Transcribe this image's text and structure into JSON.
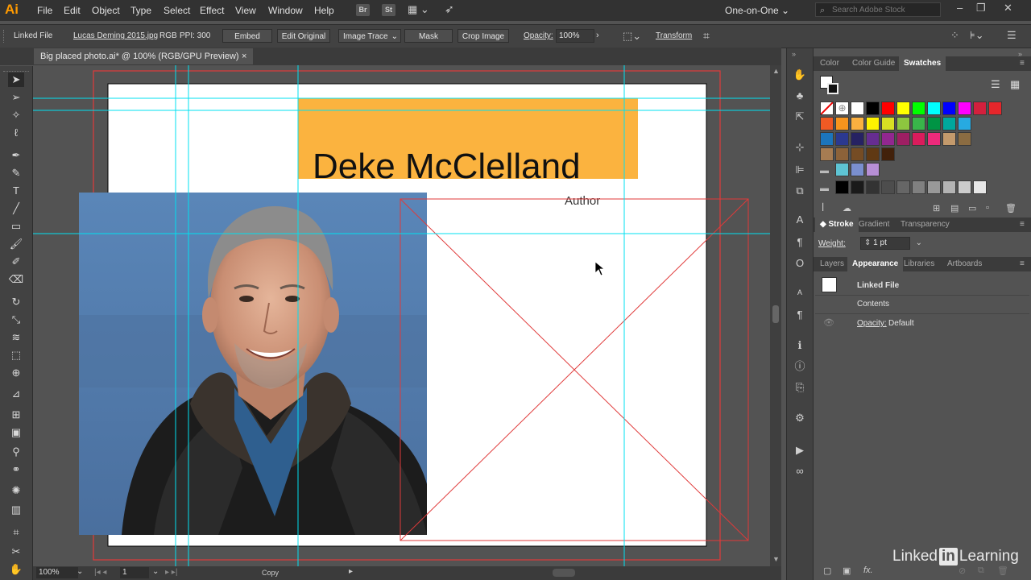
{
  "app": {
    "logo": "Ai"
  },
  "menu": [
    "File",
    "Edit",
    "Object",
    "Type",
    "Select",
    "Effect",
    "View",
    "Window",
    "Help"
  ],
  "menubar_icons": [
    "Br",
    "St"
  ],
  "workspace": "One-on-One",
  "stock_search": {
    "placeholder": "Search Adobe Stock"
  },
  "control_bar": {
    "object_type": "Linked File",
    "file_name": "Lucas Deming 2015.jpg",
    "color_mode": "RGB",
    "ppi": "PPI: 300",
    "embed": "Embed",
    "edit_original": "Edit Original",
    "image_trace": "Image Trace",
    "mask": "Mask",
    "crop_image": "Crop Image",
    "opacity_label": "Opacity:",
    "opacity_value": "100%",
    "transform": "Transform"
  },
  "document_tab": {
    "title": "Big placed photo.ai* @ 100% (RGB/GPU Preview)",
    "close": "×"
  },
  "artboard": {
    "name_text": "Deke McClelland",
    "subtitle_text": "Author",
    "accent_color": "#fbb33f",
    "frame_color": "#e03a3a",
    "guide_color": "#00e0f0"
  },
  "status_bar": {
    "zoom": "100%",
    "artboard_num": "1",
    "tool_label": "Copy"
  },
  "panels": {
    "color_tabs": [
      "Color",
      "Color Guide",
      "Swatches"
    ],
    "stroke_tabs": [
      "Stroke",
      "Gradient",
      "Transparency"
    ],
    "stroke_weight_label": "Weight:",
    "stroke_weight_value": "1 pt",
    "appearance_tabs": [
      "Layers",
      "Appearance",
      "Libraries",
      "Artboards"
    ],
    "appearance_object": "Linked File",
    "appearance_contents": "Contents",
    "appearance_opacity_label": "Opacity:",
    "appearance_opacity_value": "Default",
    "fx_label": "fx."
  },
  "swatches": {
    "row1": [
      "#ffffff",
      "#000000",
      "#ff0000",
      "#ffff00",
      "#00ff00",
      "#00ffff",
      "#0000ff",
      "#ff00ff",
      "#d3203d",
      "#e5262b"
    ],
    "row2": [
      "#f05a24",
      "#f7941d",
      "#fbb040",
      "#fff200",
      "#d7df23",
      "#8dc63f",
      "#39b54a",
      "#009444",
      "#00a79d",
      "#27aae1"
    ],
    "row3": [
      "#1c75bc",
      "#2b3990",
      "#262262",
      "#662d91",
      "#92278f",
      "#9e1f63",
      "#da1c5c",
      "#ee2a7b",
      "#c49a6c",
      "#8b6c42"
    ],
    "row4": [
      "#a67c52",
      "#8c6239",
      "#754c24",
      "#603913",
      "#42210b"
    ],
    "row5": [
      "#5ec4d4",
      "#7a8fcf",
      "#b78fd6"
    ],
    "row6": [
      "#000000",
      "#1a1a1a",
      "#333333",
      "#4d4d4d",
      "#666666",
      "#808080",
      "#999999",
      "#b3b3b3",
      "#cccccc",
      "#e6e6e6"
    ]
  },
  "watermark": {
    "brand_a": "Linked",
    "brand_in": "in",
    "brand_b": "Learning"
  }
}
